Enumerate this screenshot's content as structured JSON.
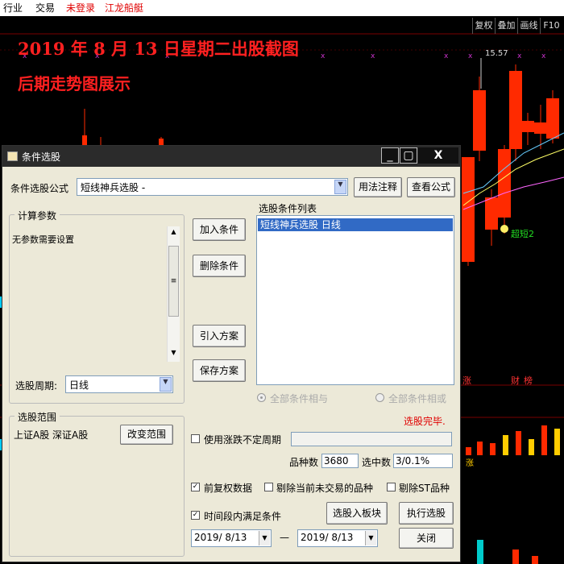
{
  "menubar": {
    "items": [
      "行业",
      "交易",
      "未登录",
      "江龙船艇"
    ]
  },
  "chart_toolbar": {
    "buttons": [
      "复权",
      "叠加",
      "画线",
      "F10"
    ]
  },
  "overlay_titles": {
    "line1": "2019 年 8 月 13 日星期二出股截图",
    "line2": "后期走势图展示"
  },
  "chart_labels": {
    "high_price": "15.57",
    "signal": "超短2",
    "rise_tag": "涨",
    "finance_tag": "财",
    "news_tag": "榜",
    "vol_tag": "涨"
  },
  "colors": {
    "up_candle": "#ff2a00",
    "brand_red": "#ff2020",
    "dialog_bg": "#ece9d8",
    "selection": "#316ac5",
    "status_red": "#e00000"
  },
  "dialog": {
    "title": "条件选股",
    "close_symbol": "X",
    "formula_label": "条件选股公式",
    "formula_value": "短线神兵选股 -",
    "usage_button": "用法注释",
    "view_formula_button": "查看公式",
    "params_group": "计算参数",
    "params_text": "无参数需要设置",
    "period_label": "选股周期:",
    "period_value": "日线",
    "scope_group": "选股范围",
    "scope_text": "上证A股 深证A股",
    "change_scope_button": "改变范围",
    "add_condition_button": "加入条件",
    "delete_condition_button": "删除条件",
    "import_plan_button": "引入方案",
    "save_plan_button": "保存方案",
    "condition_list_label": "选股条件列表",
    "condition_items": [
      "短线神兵选股  日线"
    ],
    "and_option": "全部条件相与",
    "or_option": "全部条件相或",
    "status": "选股完毕.",
    "uncertain_period": "使用涨跌不定周期",
    "count_label": "品种数",
    "count_value": "3680",
    "selected_label": "选中数",
    "selected_value": "3/0.1%",
    "pre_adjust": "前复权数据",
    "exclude_untraded": "剔除当前未交易的品种",
    "exclude_st": "剔除ST品种",
    "within_period": "时间段内满足条件",
    "to_block_button": "选股入板块",
    "execute_button": "执行选股",
    "start_date": "2019/ 8/13",
    "date_separator": "—",
    "end_date": "2019/ 8/13",
    "close_button": "关闭"
  }
}
